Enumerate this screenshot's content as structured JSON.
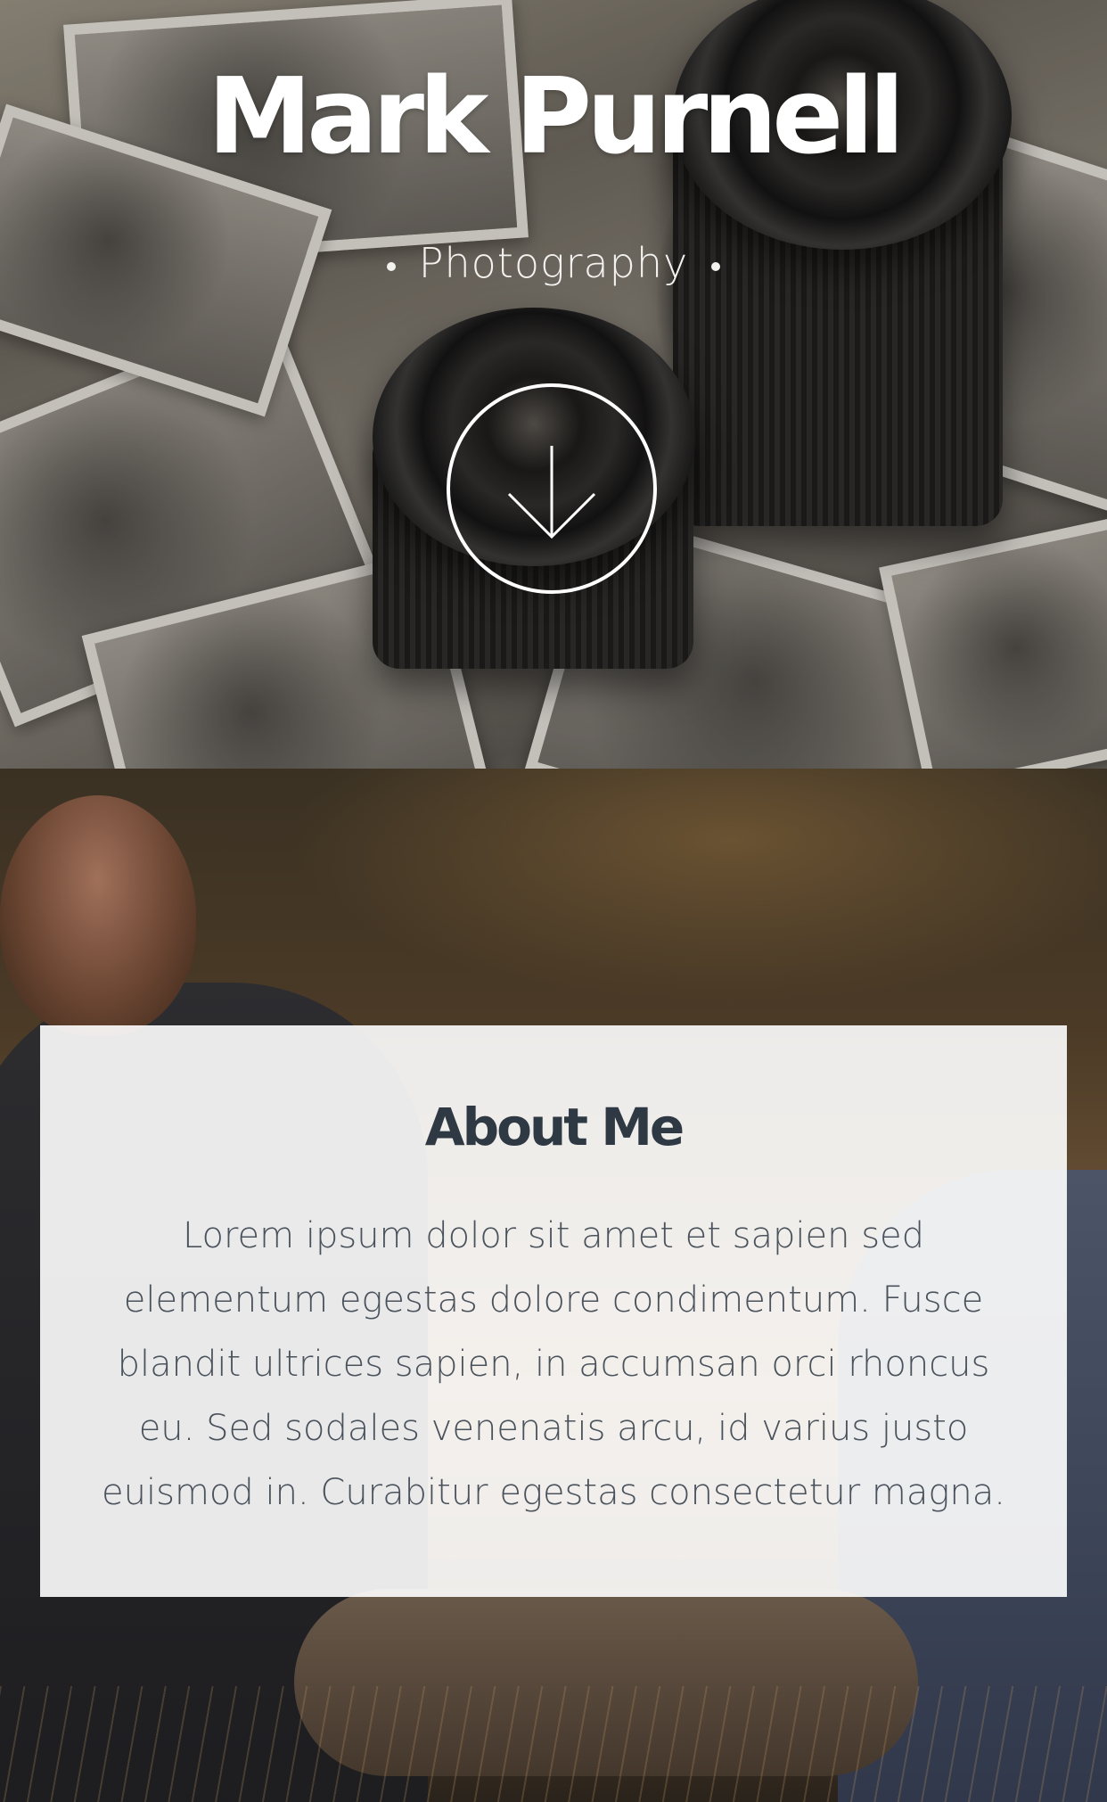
{
  "hero": {
    "title": "Mark Purnell",
    "subtitle": "Photography",
    "scroll_icon": "arrow-down-icon"
  },
  "about": {
    "heading": "About Me",
    "body": "Lorem ipsum dolor sit amet et sapien sed elementum egestas dolore condimentum. Fusce blandit ultrices sapien, in accumsan orci rhoncus eu. Sed sodales venenatis arcu, id varius justo euismod in. Curabitur egestas consectetur magna."
  },
  "colors": {
    "title_text": "#ffffff",
    "card_background": "#ffffff",
    "heading_text": "#2f3944",
    "body_text": "#4a525c"
  }
}
